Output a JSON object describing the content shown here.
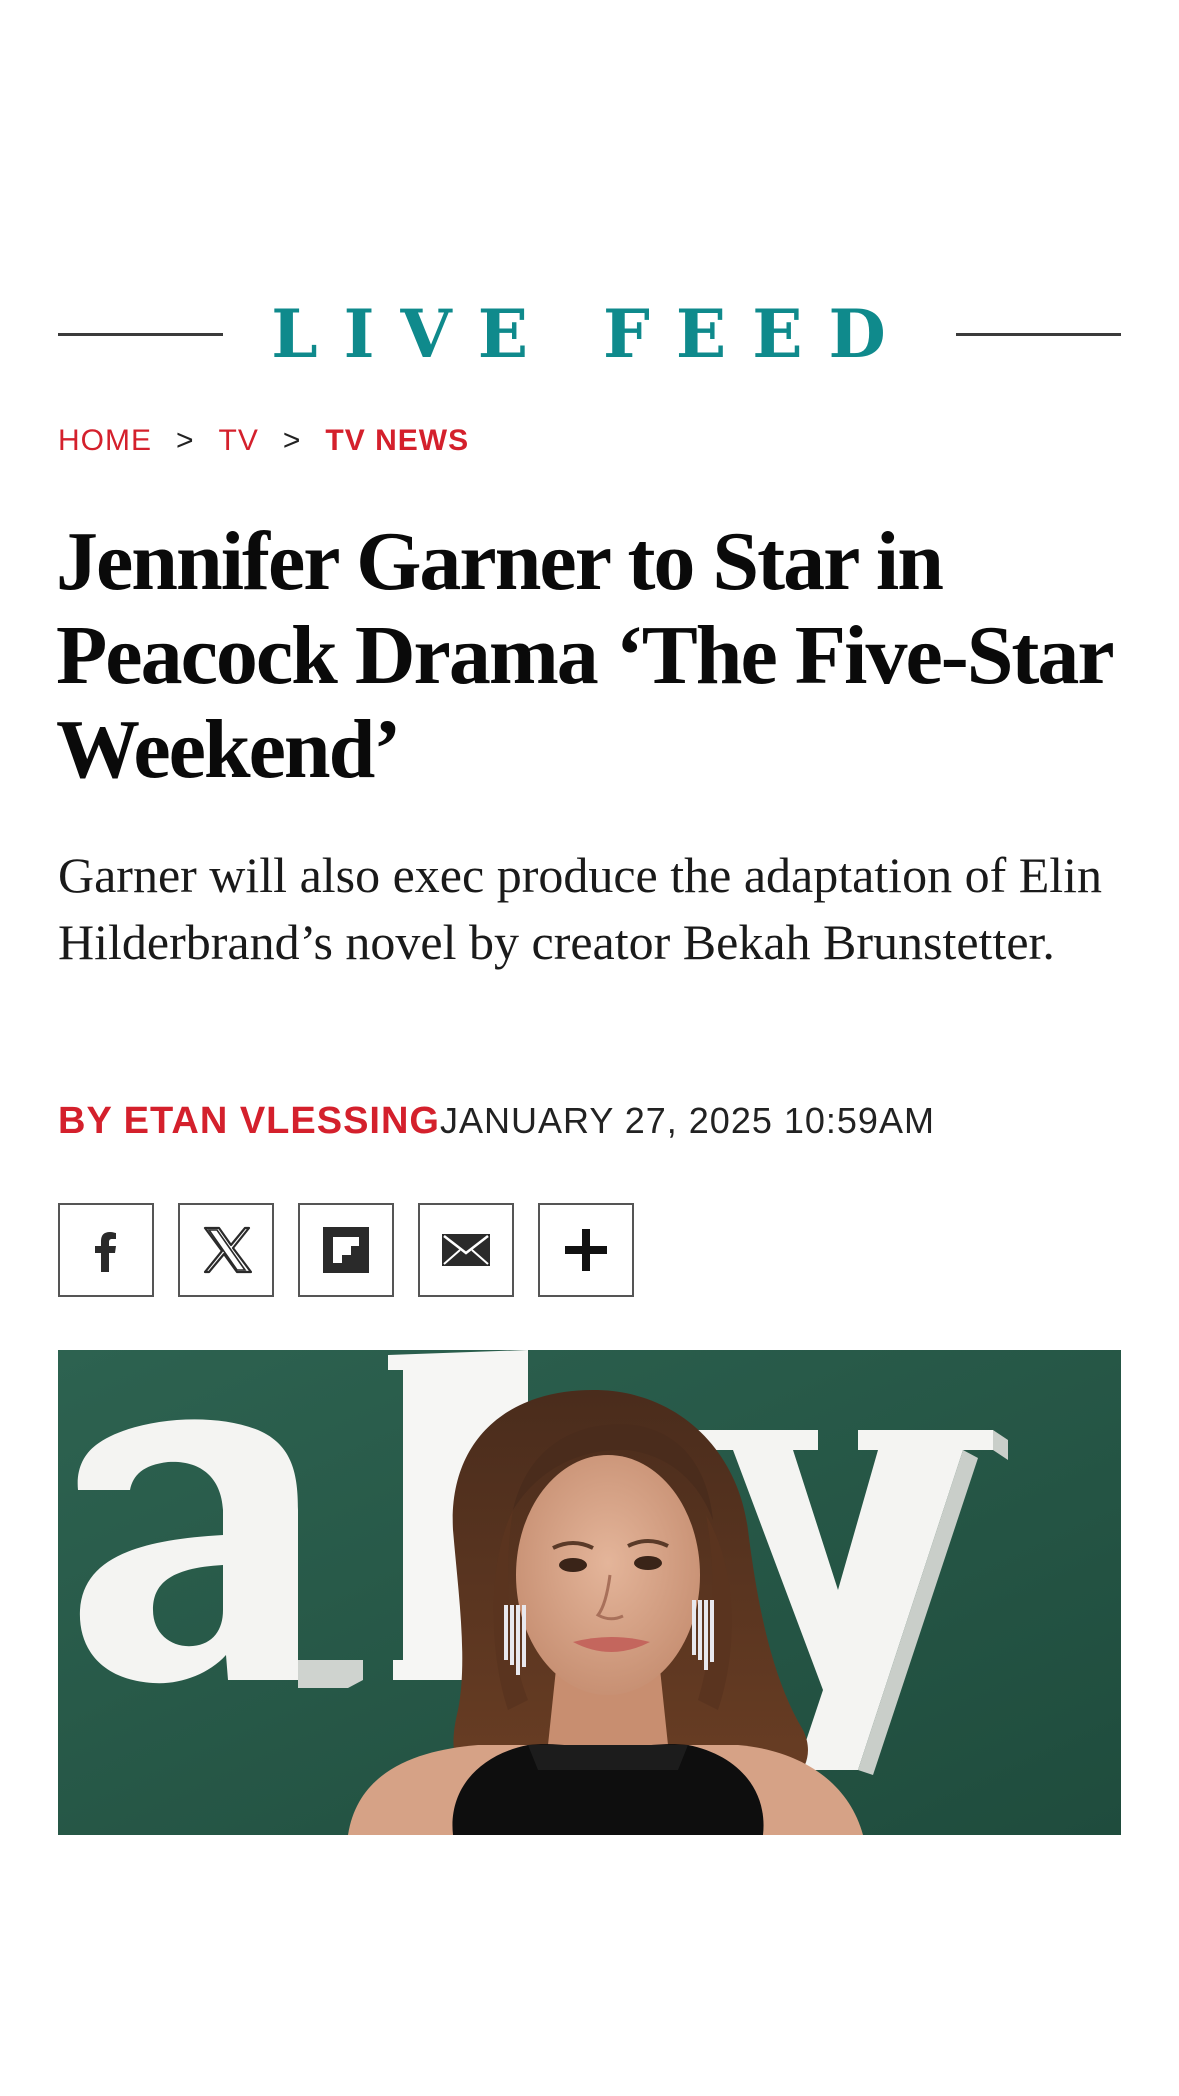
{
  "section": {
    "title": "LIVE FEED"
  },
  "breadcrumb": {
    "items": [
      {
        "label": "HOME"
      },
      {
        "label": "TV"
      },
      {
        "label": "TV NEWS"
      }
    ],
    "separator": ">"
  },
  "article": {
    "headline": "Jennifer Garner to Star in Peacock Drama ‘The Five-Star Weekend’",
    "dek": "Garner will also exec produce the adaptation of Elin Hilderbrand’s novel by creator Bekah Brunstetter.",
    "author": "BY ETAN VLESSING",
    "date": "JANUARY 27, 2025 10:59AM"
  },
  "share": {
    "buttons": [
      {
        "name": "facebook-icon"
      },
      {
        "name": "x-icon"
      },
      {
        "name": "flipboard-icon"
      },
      {
        "name": "email-icon"
      },
      {
        "name": "plus-icon"
      }
    ]
  },
  "hero": {
    "backdrop_letters": "aly",
    "backdrop_color": "#275848"
  },
  "colors": {
    "accent_teal": "#0f8a8c",
    "accent_red": "#d4202c",
    "text": "#0a0a0a"
  }
}
